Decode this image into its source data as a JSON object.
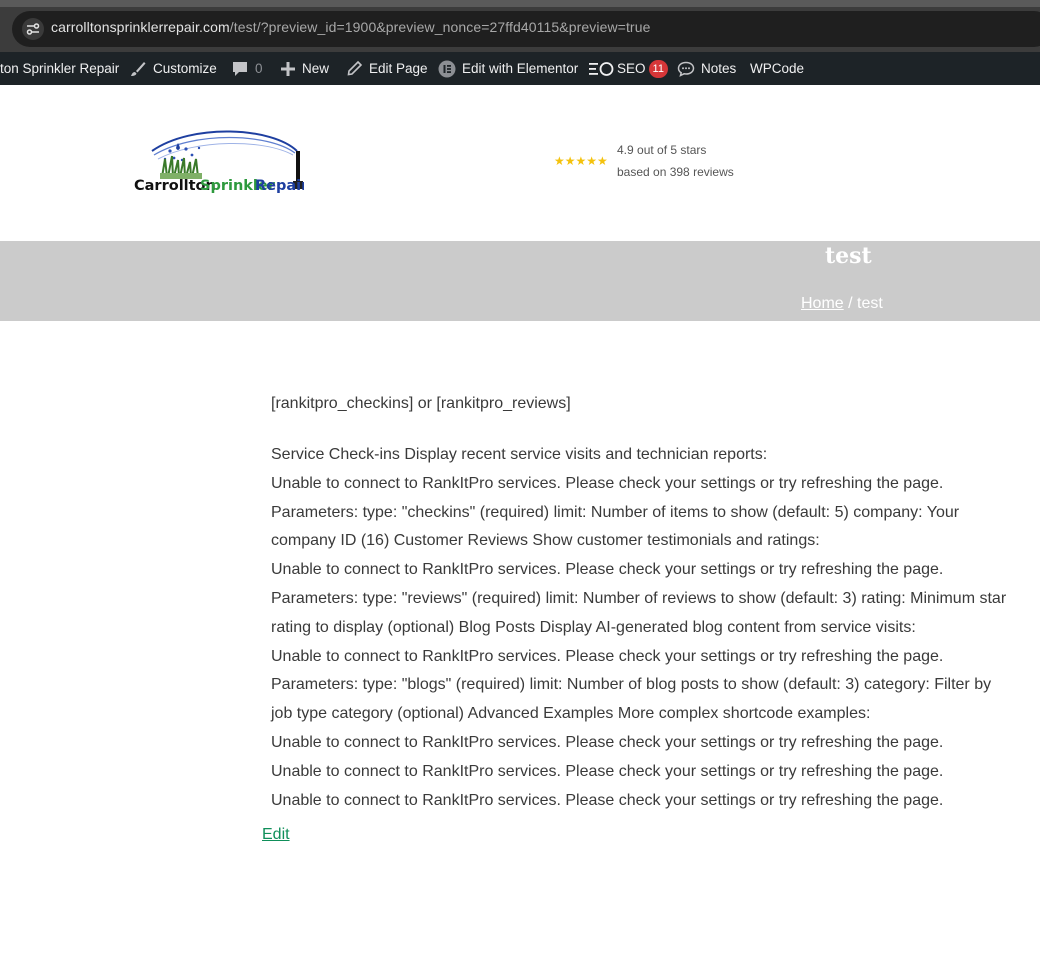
{
  "browser": {
    "url_host": "carrolltonsprinklerrepair.com",
    "url_path": "/test/?preview_id=1900&preview_nonce=27ffd40115&preview=true"
  },
  "adminbar": {
    "site_name": "ton Sprinkler Repair",
    "customize": "Customize",
    "comments_count": "0",
    "new": "New",
    "edit_page": "Edit Page",
    "edit_elementor": "Edit with Elementor",
    "seo": "SEO",
    "seo_badge": "11",
    "notes": "Notes",
    "wpcode": "WPCode"
  },
  "header": {
    "logo_text": "Carrollton Sprinkler Repair",
    "stars": "★★★★★",
    "rating_line1": "4.9 out of 5 stars",
    "rating_line2": "based on 398 reviews"
  },
  "title_bar": {
    "title": "test",
    "breadcrumb_home": "Home",
    "breadcrumb_sep": " / ",
    "breadcrumb_current": "test"
  },
  "content": {
    "shortcode_line": "[rankitpro_checkins] or [rankitpro_reviews]",
    "lines": [
      "Service Check-ins Display recent service visits and technician reports:",
      "Unable to connect to RankItPro services. Please check your settings or try refreshing the page.",
      "Parameters: type: \"checkins\" (required) limit: Number of items to show (default: 5) company: Your",
      "company ID (16) Customer Reviews Show customer testimonials and ratings:",
      "Unable to connect to RankItPro services. Please check your settings or try refreshing the page.",
      "Parameters: type: \"reviews\" (required) limit: Number of reviews to show (default: 3) rating: Minimum star",
      "rating to display (optional) Blog Posts Display AI-generated blog content from service visits:",
      "Unable to connect to RankItPro services. Please check your settings or try refreshing the page.",
      "Parameters: type: \"blogs\" (required) limit: Number of blog posts to show (default: 3) category: Filter by",
      "job type category (optional) Advanced Examples More complex shortcode examples:",
      "Unable to connect to RankItPro services. Please check your settings or try refreshing the page.",
      "Unable to connect to RankItPro services. Please check your settings or try refreshing the page.",
      "Unable to connect to RankItPro services. Please check your settings or try refreshing the page."
    ],
    "edit_link": "Edit"
  },
  "colors": {
    "admin_bar": "#1d2327",
    "title_bar": "#cbcbcb",
    "edit_link": "#0f8f5a",
    "star": "#f4c20d",
    "badge": "#d63638"
  }
}
